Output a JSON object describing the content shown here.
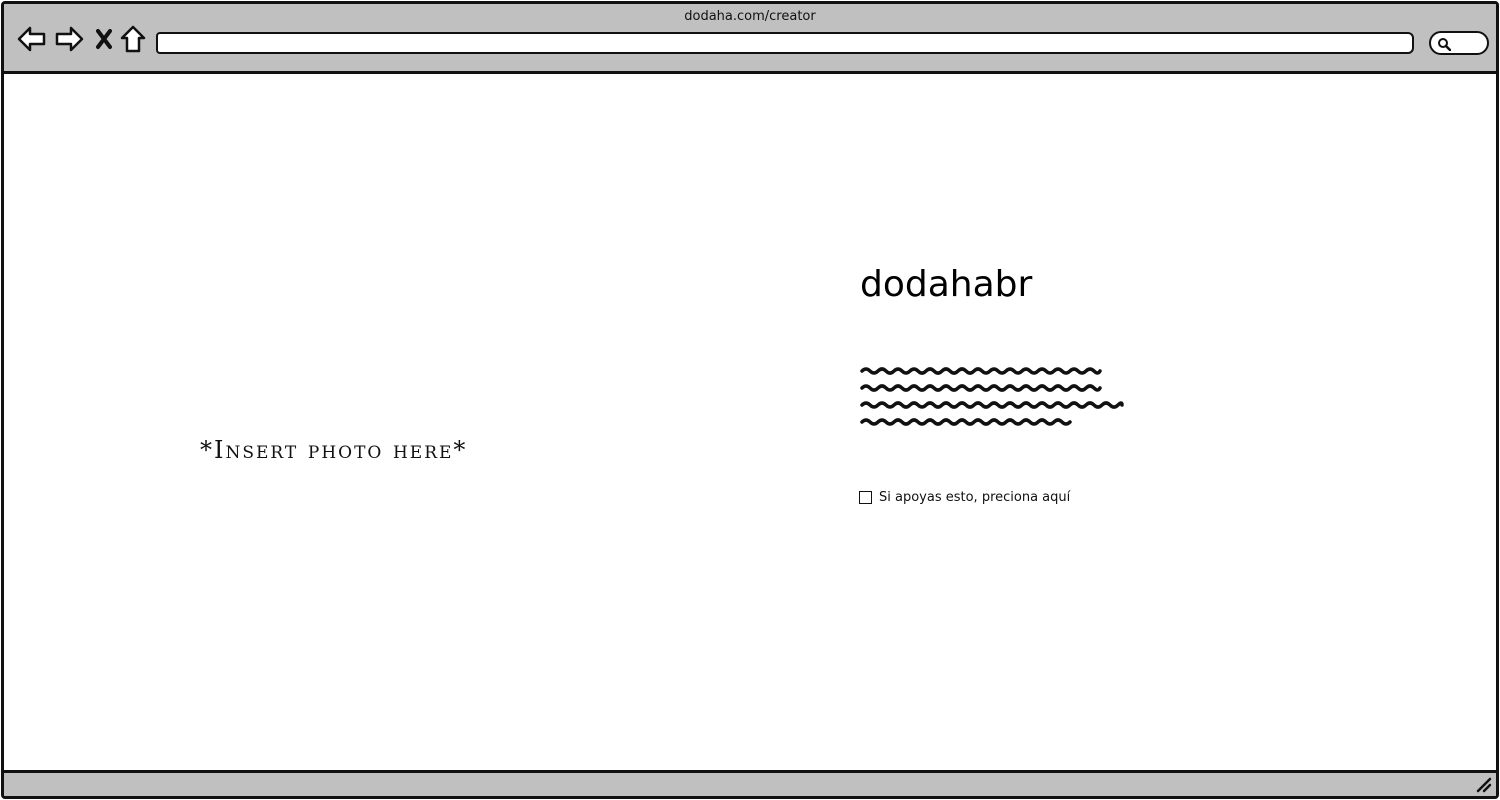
{
  "window": {
    "title": "dodaha.com/creator",
    "address_value": ""
  },
  "toolbar": {
    "icons": [
      "back-arrow-icon",
      "forward-arrow-icon",
      "close-icon",
      "home-icon",
      "search-icon"
    ]
  },
  "main": {
    "photo_placeholder": "*Insert photo here*",
    "creator_name": "dodahabr",
    "support_checkbox": {
      "label": "Si apoyas esto, preciona aquí",
      "checked": false
    }
  },
  "colors": {
    "chrome": "#c0c0c0",
    "outline": "#111111",
    "background": "#ffffff"
  }
}
